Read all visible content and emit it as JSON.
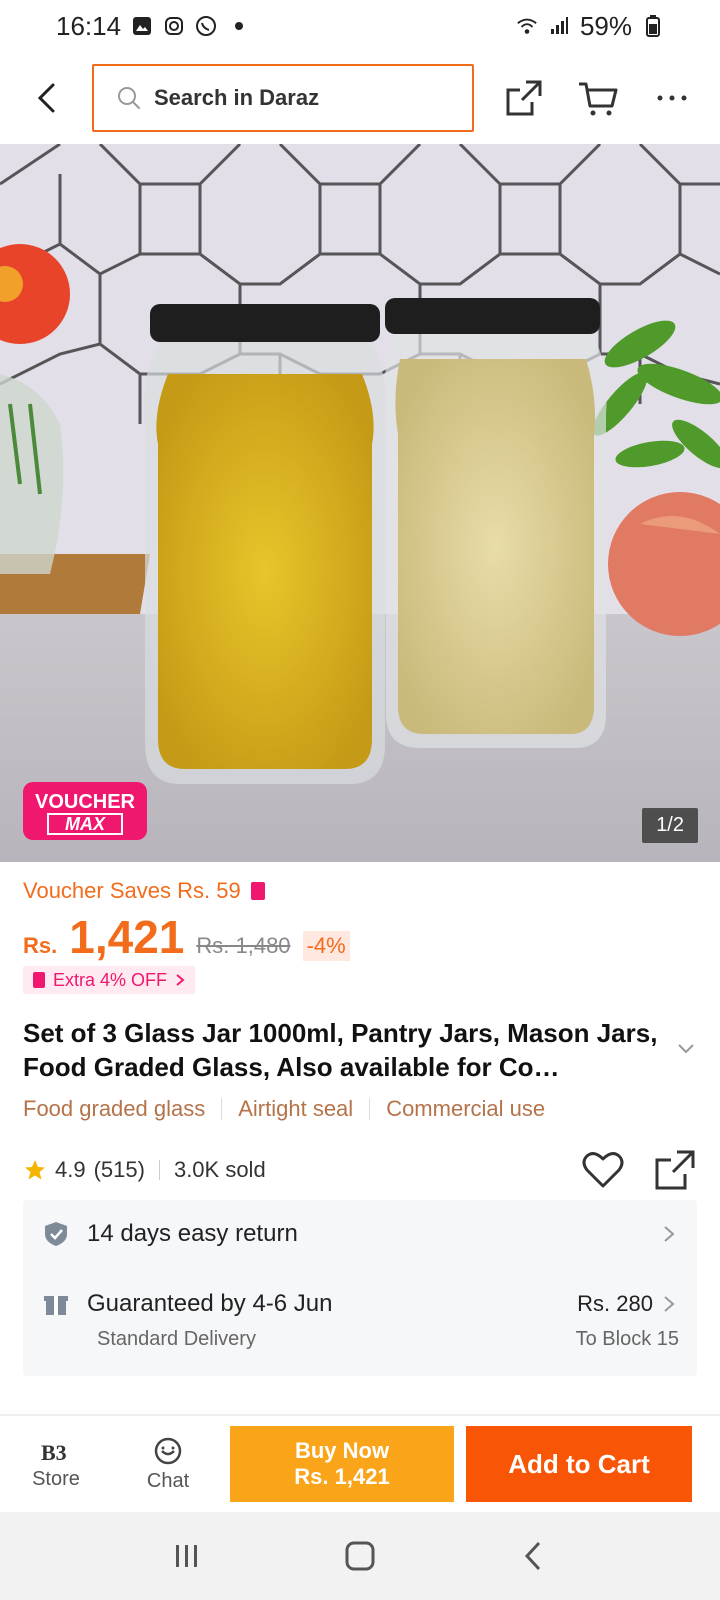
{
  "status_bar": {
    "time": "16:14",
    "battery": "59%"
  },
  "header": {
    "search_placeholder": "Search in Daraz"
  },
  "hero": {
    "voucher_badge_line1": "VOUCHER",
    "voucher_badge_line2": "MAX",
    "pager": "1/2"
  },
  "pricing": {
    "voucher_saves": "Voucher Saves Rs. 59",
    "currency": "Rs.",
    "price": "1,421",
    "original_price": "Rs. 1,480",
    "discount": "-4%",
    "extra_off": "Extra 4% OFF"
  },
  "product": {
    "title": "Set of 3 Glass Jar 1000ml, Pantry Jars, Mason Jars, Food Graded Glass, Also available for Co…",
    "features": [
      "Food graded glass",
      "Airtight seal",
      "Commercial use"
    ],
    "rating": "4.9",
    "reviews": "(515)",
    "sold": "3.0K sold"
  },
  "service": {
    "return_label": "14 days easy return",
    "delivery_label": "Guaranteed by 4-6 Jun",
    "delivery_sub": "Standard Delivery",
    "delivery_price": "Rs. 280",
    "delivery_dest": "To Block 15"
  },
  "bottom_bar": {
    "store_label": "Store",
    "chat_label": "Chat",
    "buy_now_line1": "Buy Now",
    "buy_now_line2": "Rs. 1,421",
    "add_to_cart": "Add to Cart"
  },
  "colors": {
    "accent": "#f36c1c",
    "voucher_pink": "#f0176f",
    "buy_now": "#faa41a",
    "add_cart": "#f85606"
  }
}
